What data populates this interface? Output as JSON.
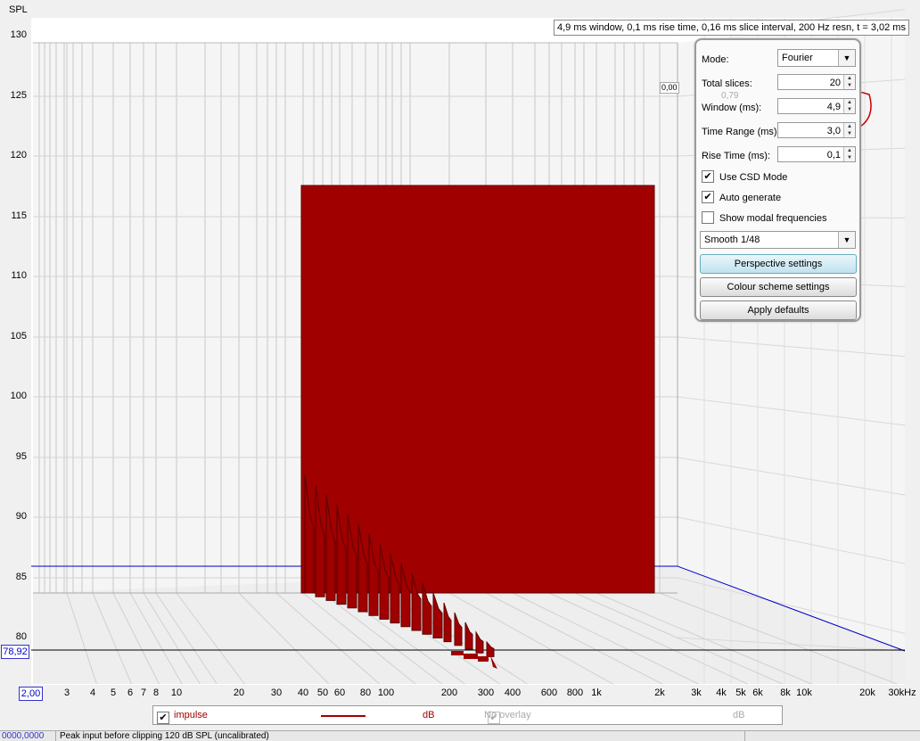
{
  "axes": {
    "y_title": "SPL",
    "y_ticks": [
      "130",
      "125",
      "120",
      "115",
      "110",
      "105",
      "100",
      "95",
      "90",
      "85",
      "80"
    ],
    "x_ticks": [
      "3",
      "4",
      "5",
      "6",
      "7",
      "8",
      "10",
      "20",
      "30",
      "40",
      "50",
      "60",
      "80",
      "100",
      "200",
      "300",
      "400",
      "600",
      "800",
      "1k",
      "2k",
      "3k",
      "4k",
      "5k",
      "6k",
      "8k",
      "10k",
      "20k",
      "30kHz"
    ],
    "x_start_value": "2,00",
    "y_cursor_value": "78,92",
    "z_corner_value": "0,00"
  },
  "info_bar": "4,9 ms window, 0,1 ms rise time, 0,16 ms slice interval, 200 Hz resn, t = 3,02 ms",
  "panel": {
    "mode_label": "Mode:",
    "mode_value": "Fourier",
    "total_slices_label": "Total slices:",
    "total_slices_value": "20",
    "window_label": "Window (ms):",
    "window_value": "4,9",
    "window_hint": "0,79",
    "time_range_label": "Time Range (ms):",
    "time_range_value": "3,0",
    "rise_time_label": "Rise Time (ms):",
    "rise_time_value": "0,1",
    "use_csd_label": "Use CSD Mode",
    "use_csd_checked": true,
    "auto_generate_label": "Auto generate",
    "auto_generate_checked": true,
    "show_modal_label": "Show modal frequencies",
    "show_modal_checked": false,
    "smoothing_value": "Smooth 1/48",
    "perspective_button": "Perspective settings",
    "colour_button": "Colour scheme settings",
    "apply_button": "Apply defaults"
  },
  "legend": {
    "impulse_label": "impulse",
    "impulse_units": "dB",
    "no_overlay_label": "No overlay",
    "no_overlay_units": "dB"
  },
  "status": {
    "left_text": "0000,0000",
    "message": "Peak input before clipping 120 dB SPL (uncalibrated)"
  },
  "colors": {
    "waterfall_fill": "#a00000",
    "waterfall_edge": "#5a0000",
    "grid": "#c8c8c8",
    "blue_line": "#0000cc",
    "annotation_red": "#cc0000"
  }
}
